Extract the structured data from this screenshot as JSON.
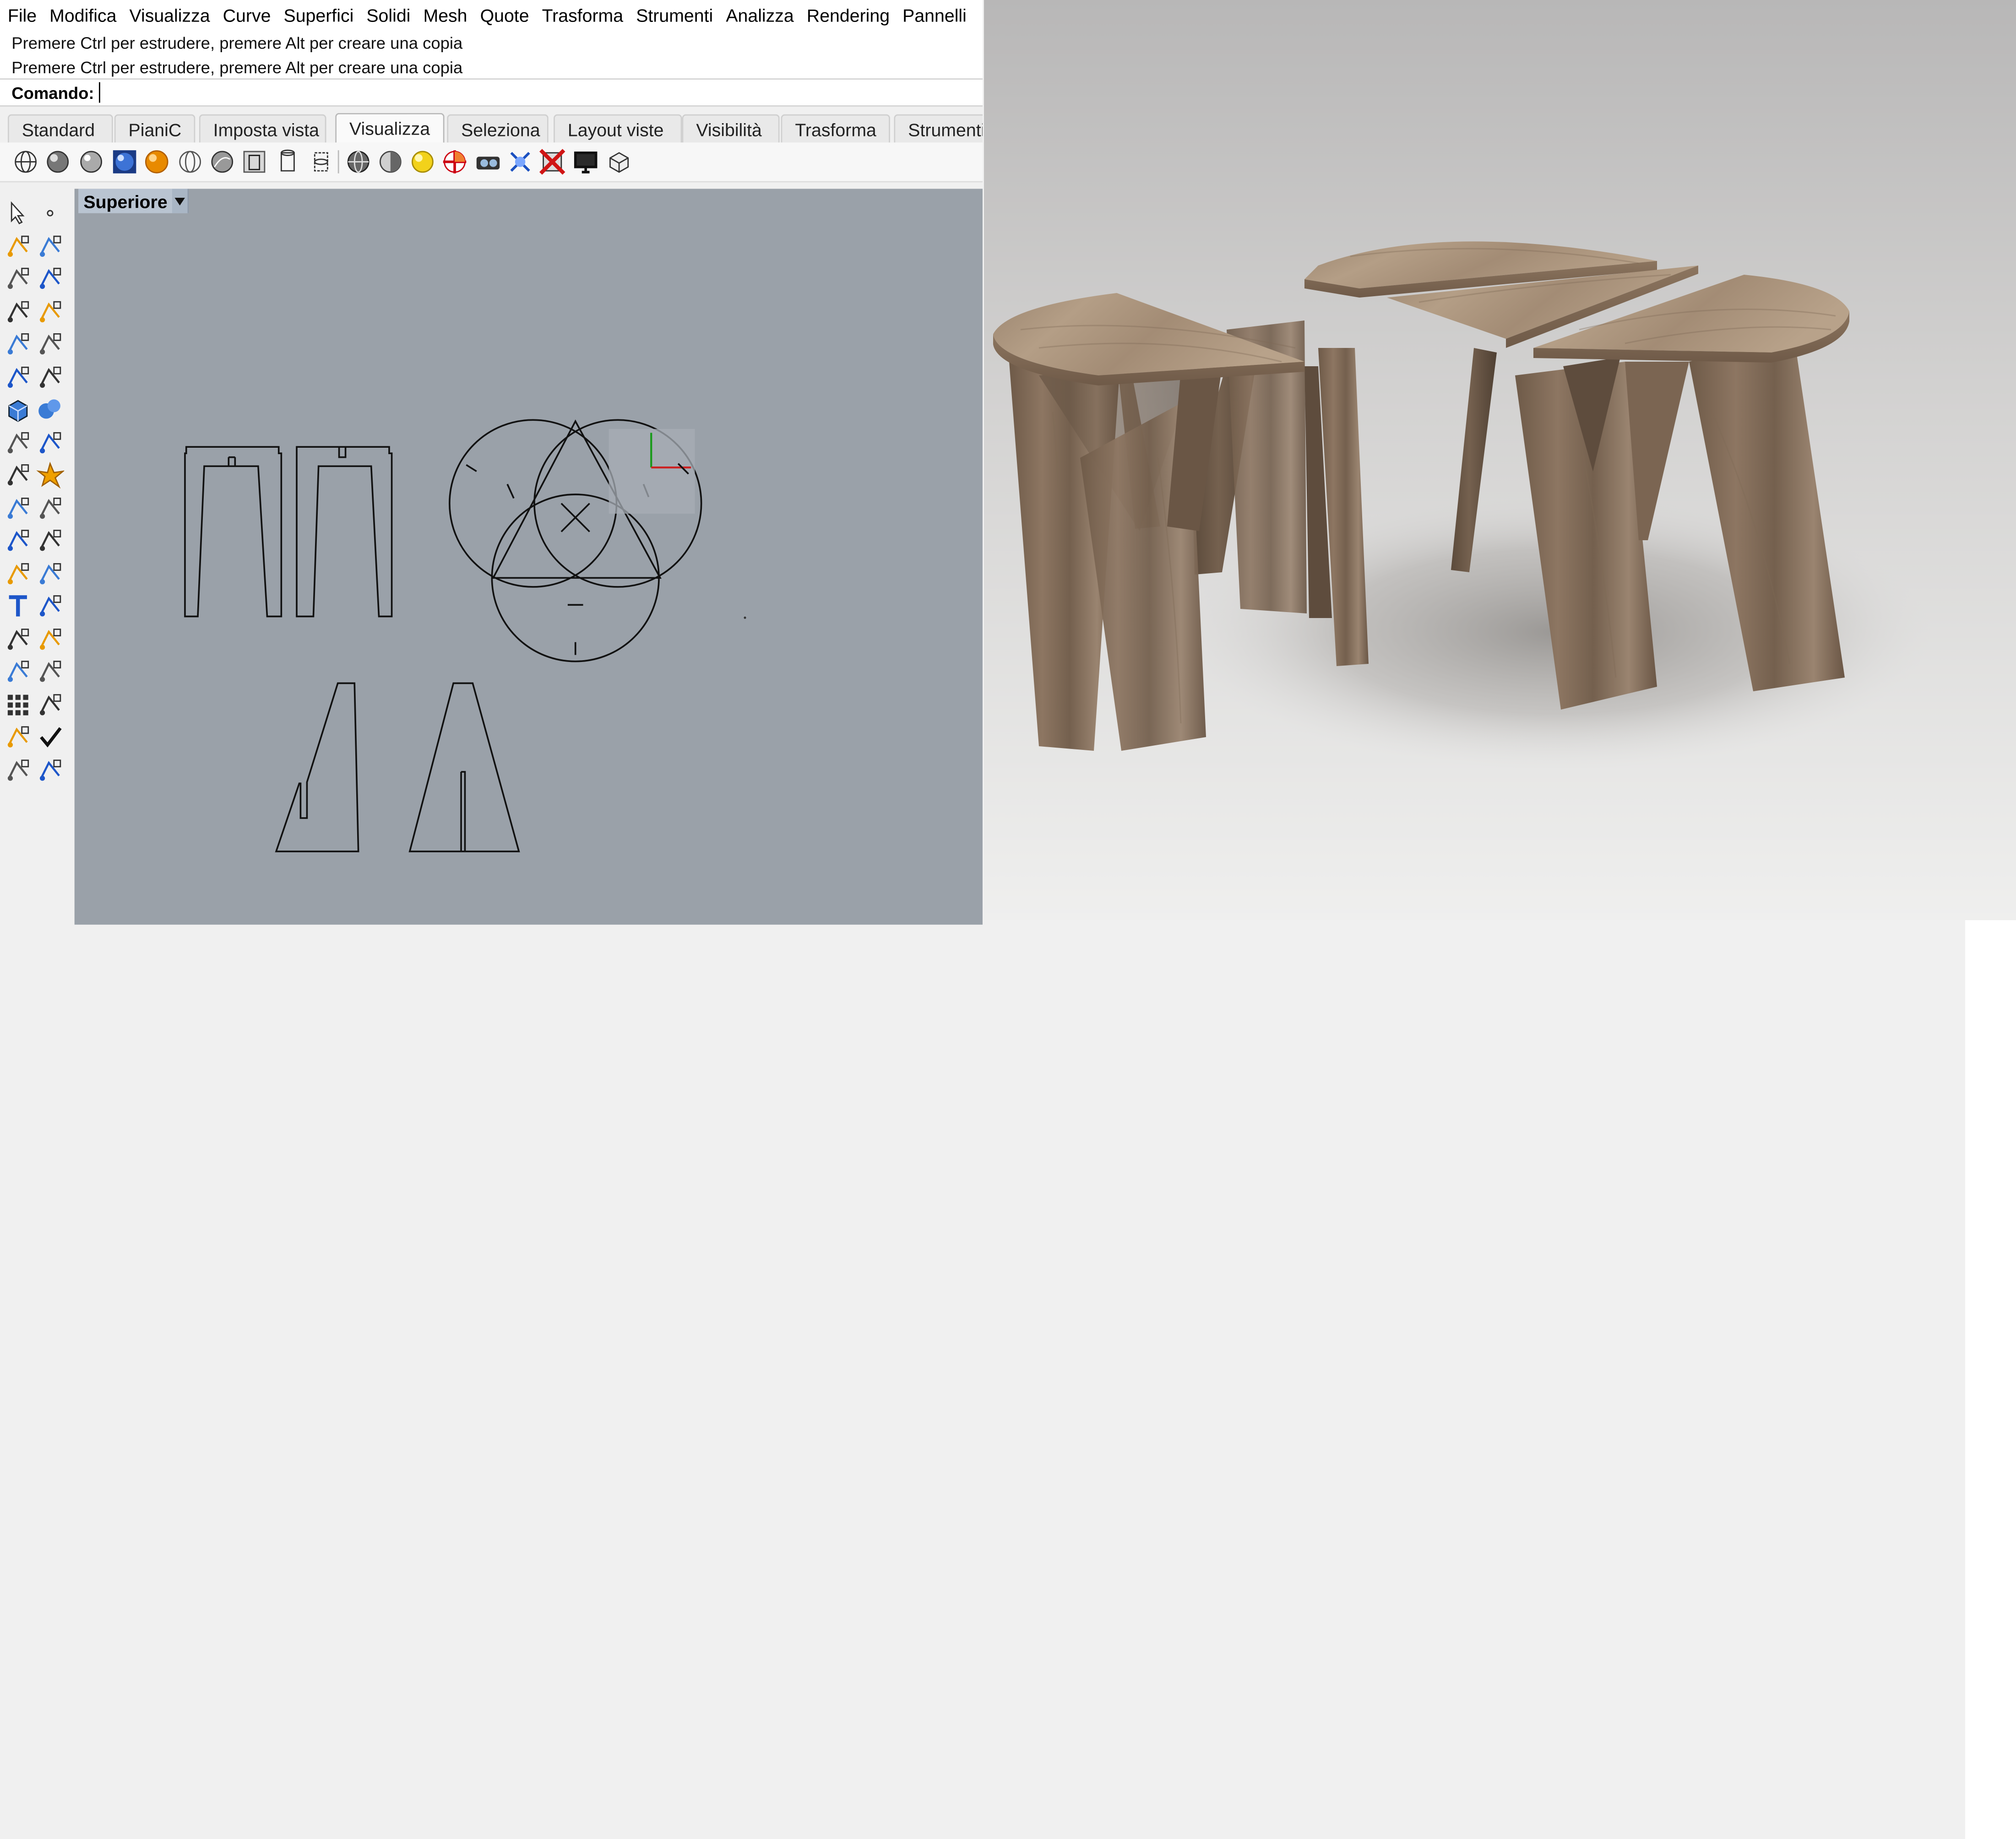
{
  "menu": [
    "File",
    "Modifica",
    "Visualizza",
    "Curve",
    "Superfici",
    "Solidi",
    "Mesh",
    "Quote",
    "Trasforma",
    "Strumenti",
    "Analizza",
    "Rendering",
    "Pannelli"
  ],
  "history": [
    "Premere Ctrl per estrudere, premere Alt per creare una copia",
    "Premere Ctrl per estrudere, premere Alt per creare una copia"
  ],
  "command": {
    "label": "Comando:",
    "value": ""
  },
  "tabs": [
    "Standard",
    "PianiC",
    "Imposta vista",
    "Visualizza",
    "Seleziona",
    "Layout viste",
    "Visibilità",
    "Trasforma",
    "Strumenti"
  ],
  "active_tab": "Visualizza",
  "toolbar_icons": [
    "wireframe-icon",
    "shaded-icon",
    "rendered-icon",
    "ghosted-icon",
    "xray-icon",
    "technical-icon",
    "artistic-icon",
    "pen-icon",
    "capture-icon",
    "bounding-icon",
    "plane-icon",
    "sphere-icon",
    "light-icon",
    "target-icon",
    "camera-icon",
    "zoom-extents-icon",
    "delete-view-icon",
    "monitor-icon",
    "box-icon"
  ],
  "left_tools": [
    "select-arrow-icon",
    "point-icon",
    "polyline-icon",
    "curve-icon",
    "circle-icon",
    "ellipse-icon",
    "arc-icon",
    "rectangle-icon",
    "polygon-icon",
    "fillet-icon",
    "surface-icon",
    "loft-icon",
    "box-solid-icon",
    "sphere-solid-icon",
    "extrude-icon",
    "plane-surface-icon",
    "gear-icon",
    "explode-icon",
    "dimension-icon",
    "align-icon",
    "boolean-icon",
    "group-icon",
    "trim-icon",
    "split-icon",
    "text-icon",
    "transform-icon",
    "array-icon",
    "copy-icon",
    "block-icon",
    "measure-icon",
    "grid-array-icon",
    "history-icon",
    "layer-icon",
    "check-icon",
    "mesh-tool-icon",
    "render-tool-icon"
  ],
  "viewport": {
    "name": "Superiore"
  },
  "colors": {
    "viewport_bg": "#9aa1a9",
    "active_tab_bg": "#fafafa",
    "viewport_tab_bg": "#b9c4d1"
  }
}
